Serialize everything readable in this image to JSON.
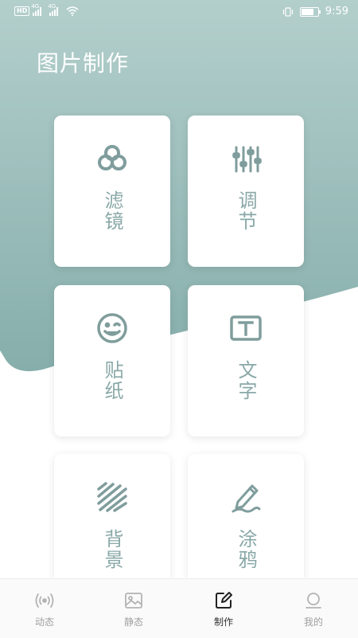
{
  "status_bar": {
    "hd": "HD",
    "net1": "4G",
    "net2": "4G",
    "time": "9:59",
    "battery_level": 0.85
  },
  "header": {
    "title": "图片制作"
  },
  "colors": {
    "teal": "#8fb4b1",
    "icon_fill": "#8ea7a6",
    "label": "#8aa8a8",
    "tab_inactive": "#a0a0a0",
    "tab_active": "#333333"
  },
  "tools": [
    {
      "label": "滤镜",
      "icon": "filter-circles-icon"
    },
    {
      "label": "调节",
      "icon": "sliders-icon"
    },
    {
      "label": "贴纸",
      "icon": "sticker-face-icon"
    },
    {
      "label": "文字",
      "icon": "text-frame-icon"
    },
    {
      "label": "背景",
      "icon": "stripes-icon"
    },
    {
      "label": "涂鸦",
      "icon": "pen-scribble-icon"
    }
  ],
  "tabbar": {
    "active": 2,
    "tabs": [
      {
        "label": "动态",
        "icon": "broadcast-icon"
      },
      {
        "label": "静态",
        "icon": "image-icon"
      },
      {
        "label": "制作",
        "icon": "edit-icon"
      },
      {
        "label": "我的",
        "icon": "profile-icon"
      }
    ]
  }
}
